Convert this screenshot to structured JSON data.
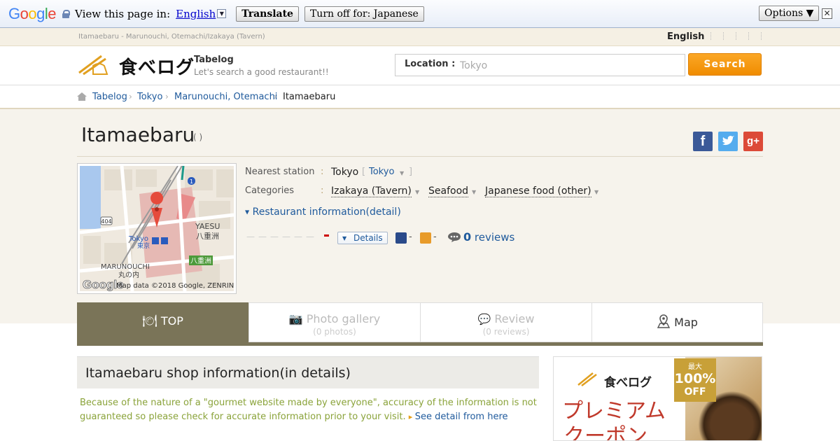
{
  "translate_bar": {
    "logo": "Google",
    "view_label": "View this page in:",
    "language": "English",
    "translate_btn": "Translate",
    "turn_off_btn": "Turn off for: Japanese",
    "options_btn": "Options ▼",
    "close": "✕"
  },
  "top_strip": {
    "crumb": "Itamaebaru - Marunouchi, Otemachi/Izakaya (Tavern)",
    "lang": "English"
  },
  "header": {
    "logo_ja": "食べログ",
    "logo_en": "Tabelog",
    "tagline": "Let's search a good restaurant!!",
    "location_label": "Location :",
    "location_placeholder": "Tokyo",
    "search_btn": "Search"
  },
  "breadcrumb": {
    "items": [
      "Tabelog",
      "Tokyo",
      "Marunouchi, Otemachi",
      "Itamaebaru"
    ]
  },
  "restaurant": {
    "name": "Itamaebaru",
    "name_sub": "( )",
    "nearest_label": "Nearest station",
    "colon": ":",
    "station": "Tokyo",
    "station_link": "Tokyo",
    "categories_label": "Categories",
    "categories": [
      "Izakaya (Tavern)",
      "Seafood",
      "Japanese food (other)"
    ],
    "info_link": "Restaurant information(detail)",
    "details_btn": "Details",
    "dinner_value": "-",
    "lunch_value": "-",
    "review_count": "0",
    "review_label": "reviews"
  },
  "map": {
    "credit": "Map data ©2018 Google, ZENRIN",
    "label_yaesu": "YAESU",
    "label_yaesu_ja": "八重洲",
    "label_tokyo": "Tokyo",
    "label_tokyo_ja": "東京",
    "label_marunouchi": "MARUNOUCHI",
    "label_marunouchi_ja": "丸の内",
    "label_yaesu_station": "八重洲",
    "route_404": "404",
    "route_1": "1",
    "google_logo": "Google"
  },
  "tabs": [
    {
      "label": "TOP",
      "sub": ""
    },
    {
      "label": "Photo gallery",
      "sub": "(0 photos)"
    },
    {
      "label": "Review",
      "sub": "(0 reviews)"
    },
    {
      "label": "Map",
      "sub": ""
    }
  ],
  "shop_info": {
    "title": "Itamaebaru shop information(in details)",
    "note": "Because of the nature of a \"gourmet website made by everyone\", accuracy of the information is not guaranteed so please check for accurate information prior to your visit.",
    "detail_link": "See detail from here"
  },
  "ad": {
    "logo": "食べログ",
    "badge_small": "最大",
    "badge_big": "100%",
    "badge_off": "OFF",
    "text1": "プレミアム",
    "text2": "クーポン"
  },
  "colors": {
    "accent_orange": "#f39800",
    "tab_active": "#7a7458",
    "link_blue": "#1f5a9c",
    "note_green": "#8aa33a"
  }
}
